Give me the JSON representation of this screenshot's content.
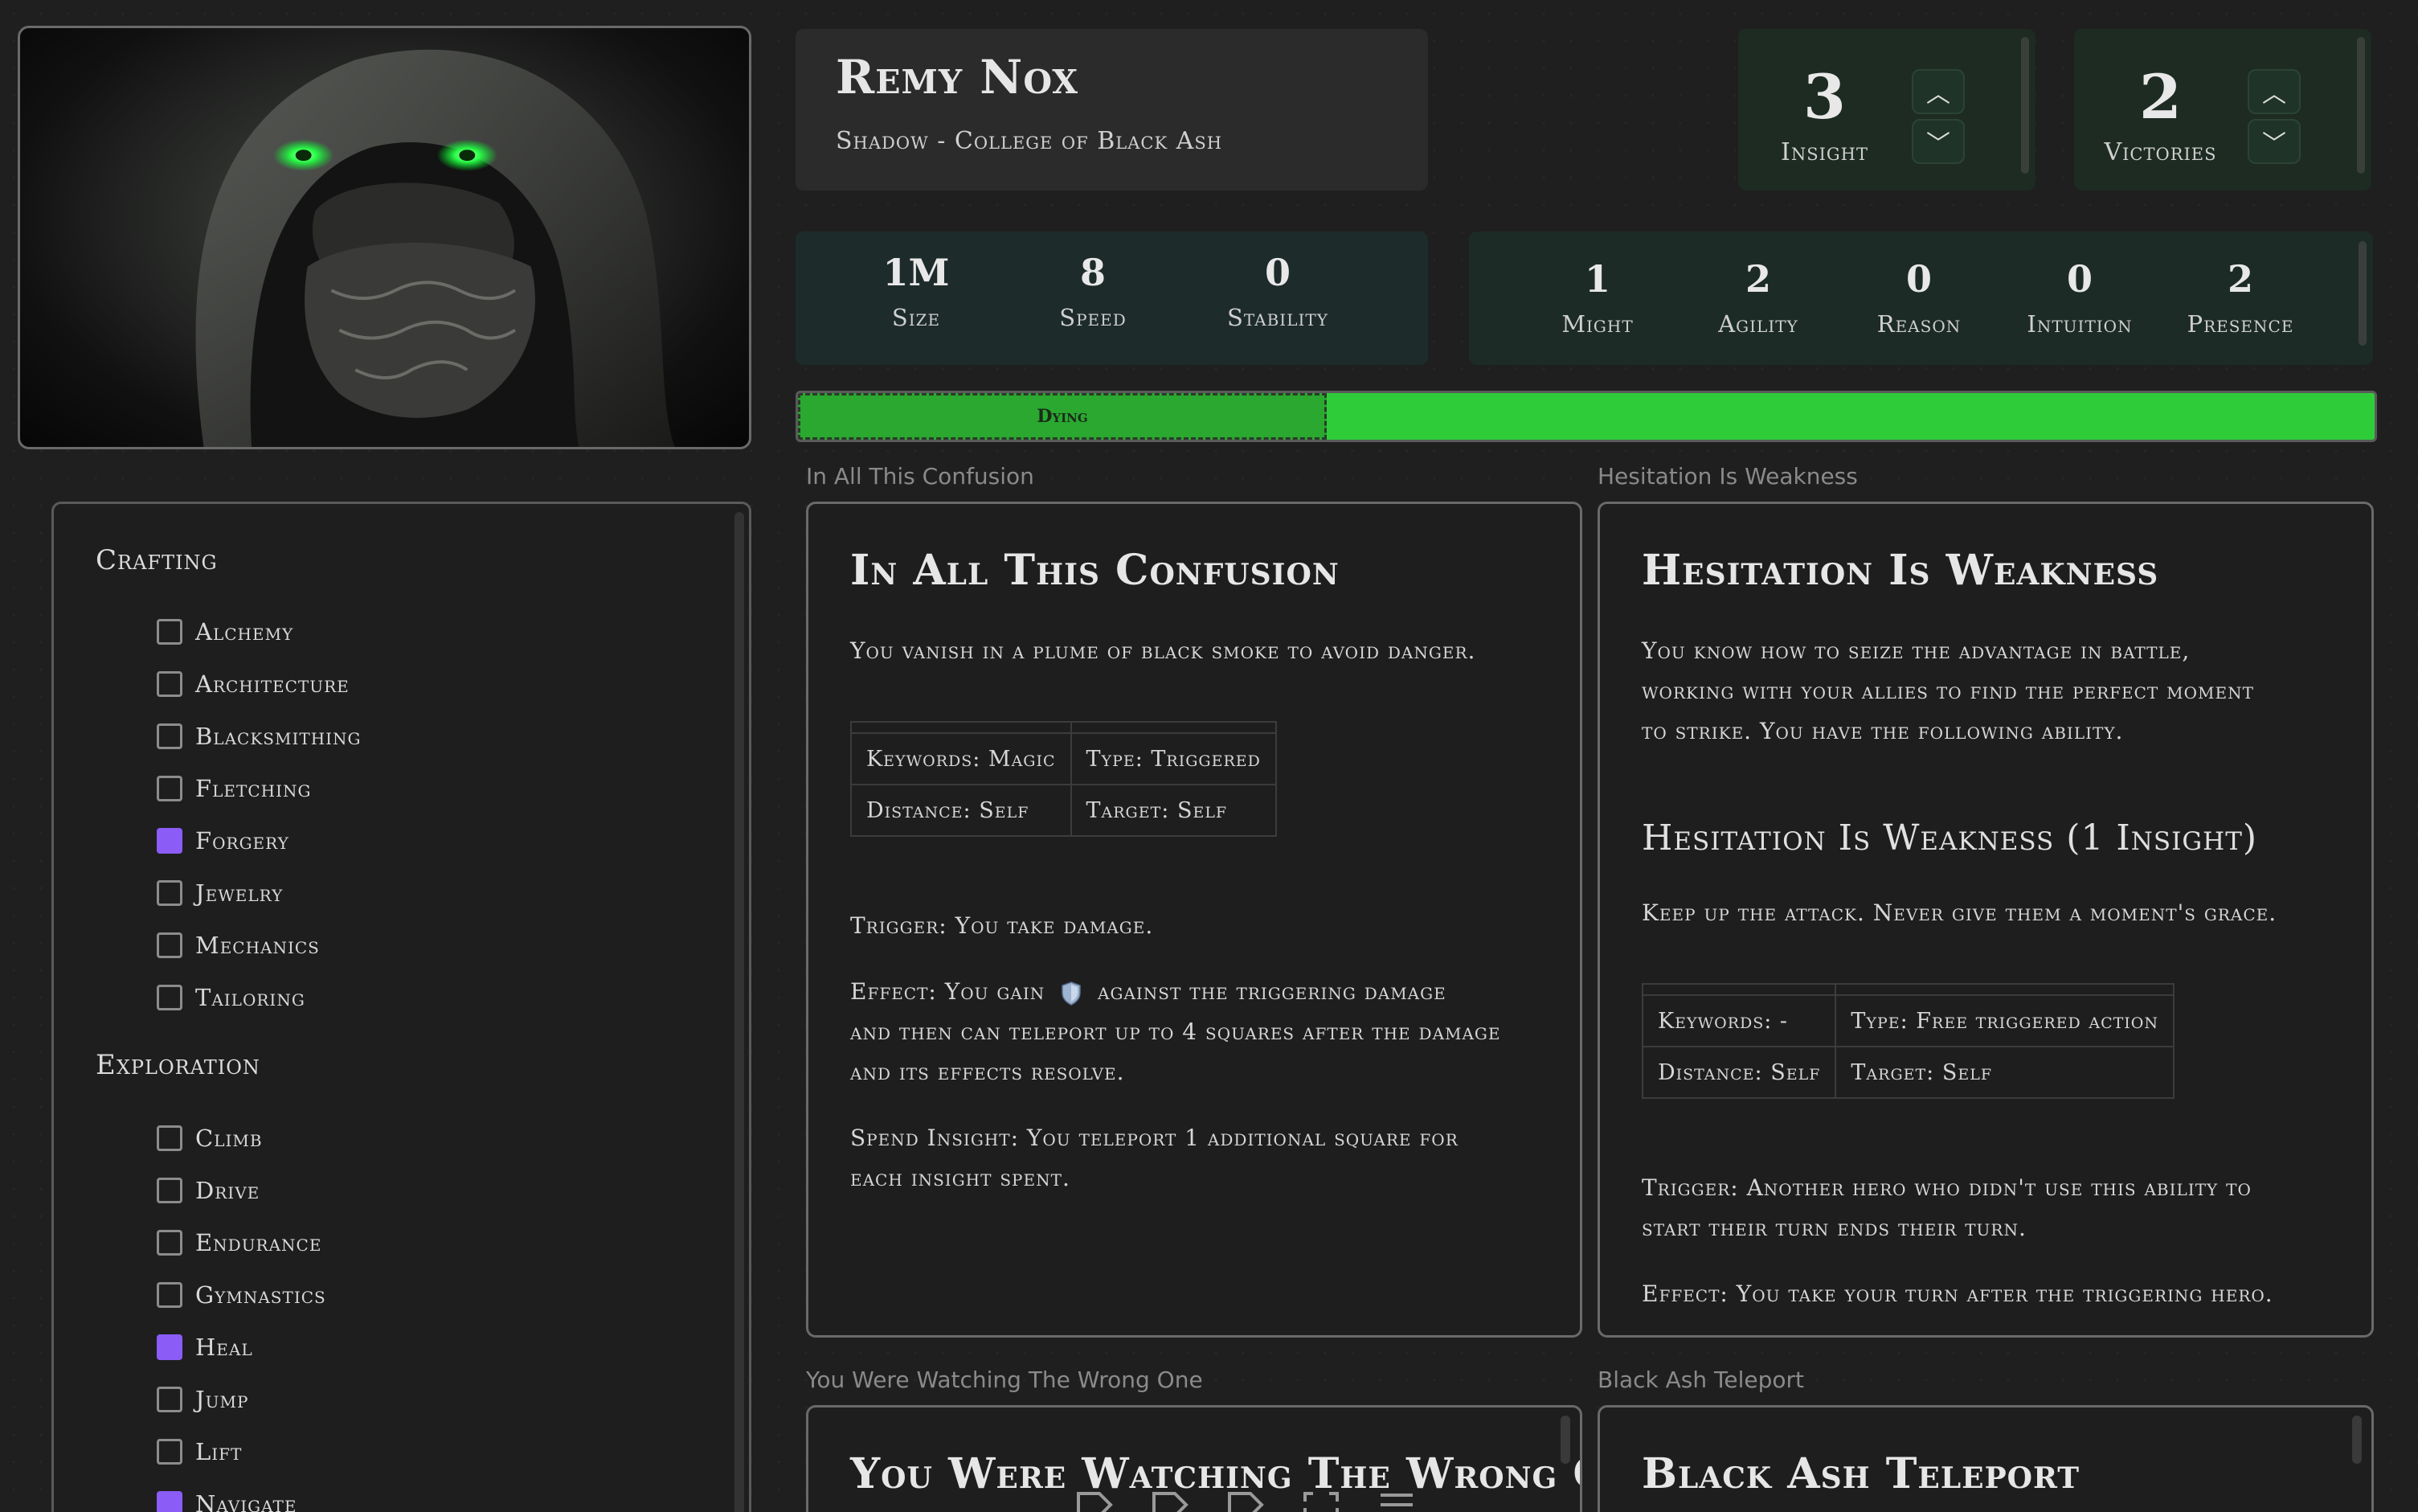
{
  "character": {
    "name": "Remy Nox",
    "subtitle": "Shadow - College of Black Ash"
  },
  "counters": [
    {
      "value": "3",
      "label": "Insight"
    },
    {
      "value": "2",
      "label": "Victories"
    }
  ],
  "core_stats": [
    {
      "value": "1M",
      "label": "Size"
    },
    {
      "value": "8",
      "label": "Speed"
    },
    {
      "value": "0",
      "label": "Stability"
    }
  ],
  "characteristics": [
    {
      "value": "1",
      "label": "Might"
    },
    {
      "value": "2",
      "label": "Agility"
    },
    {
      "value": "0",
      "label": "Reason"
    },
    {
      "value": "0",
      "label": "Intuition"
    },
    {
      "value": "2",
      "label": "Presence"
    }
  ],
  "health": {
    "dying_label": "Dying",
    "bar_color": "#2fcc3a",
    "dying_color": "#2aa830"
  },
  "skills": {
    "groups": [
      {
        "heading": "Crafting",
        "items": [
          {
            "label": "Alchemy",
            "checked": false
          },
          {
            "label": "Architecture",
            "checked": false
          },
          {
            "label": "Blacksmithing",
            "checked": false
          },
          {
            "label": "Fletching",
            "checked": false
          },
          {
            "label": "Forgery",
            "checked": true
          },
          {
            "label": "Jewelry",
            "checked": false
          },
          {
            "label": "Mechanics",
            "checked": false
          },
          {
            "label": "Tailoring",
            "checked": false
          }
        ]
      },
      {
        "heading": "Exploration",
        "items": [
          {
            "label": "Climb",
            "checked": false
          },
          {
            "label": "Drive",
            "checked": false
          },
          {
            "label": "Endurance",
            "checked": false
          },
          {
            "label": "Gymnastics",
            "checked": false
          },
          {
            "label": "Heal",
            "checked": true
          },
          {
            "label": "Jump",
            "checked": false
          },
          {
            "label": "Lift",
            "checked": false
          },
          {
            "label": "Navigate",
            "checked": true
          }
        ]
      }
    ],
    "checked_color": "#8b5cf6"
  },
  "cards": {
    "confusion": {
      "caption": "In All This Confusion",
      "title": "In All This Confusion",
      "description": "You vanish in a plume of black smoke to avoid danger.",
      "keywords": "Keywords: Magic",
      "type": "Type: Triggered",
      "distance": "Distance: Self",
      "target": "Target: Self",
      "trigger": "Trigger: You take damage.",
      "effect_1": "Effect: You gain",
      "effect_icon": "shield-icon",
      "effect_2": "against the triggering damage",
      "effect_3": "and then can teleport up to 4 squares after the damage",
      "effect_4": "and its effects resolve.",
      "spend_1": "Spend Insight: You teleport 1 additional square for",
      "spend_2": "each insight spent."
    },
    "hesitation": {
      "caption": "Hesitation Is Weakness",
      "title": "Hesitation Is Weakness",
      "desc_1": "You know how to seize the advantage in battle,",
      "desc_2": "working with your allies to find the perfect moment",
      "desc_3": "to strike. You have the following ability.",
      "subtitle": "Hesitation Is Weakness (1 Insight)",
      "flavor": "Keep up the attack. Never give them a moment's grace.",
      "keywords": "Keywords: -",
      "type": "Type: Free triggered action",
      "distance": "Distance: Self",
      "target": "Target: Self",
      "trigger_1": "Trigger: Another hero who didn't use this ability to",
      "trigger_2": "start their turn ends their turn.",
      "effect": "Effect: You take your turn after the triggering hero."
    },
    "watching": {
      "caption": "You Were Watching The Wrong One",
      "title": "You Were Watching The Wrong One"
    },
    "teleport": {
      "caption": "Black Ash Teleport",
      "title": "Black Ash Teleport"
    }
  },
  "toolbar": {
    "icons": [
      "tag-icon",
      "tag-icon",
      "tag-icon",
      "expand-icon",
      "menu-icon"
    ]
  }
}
